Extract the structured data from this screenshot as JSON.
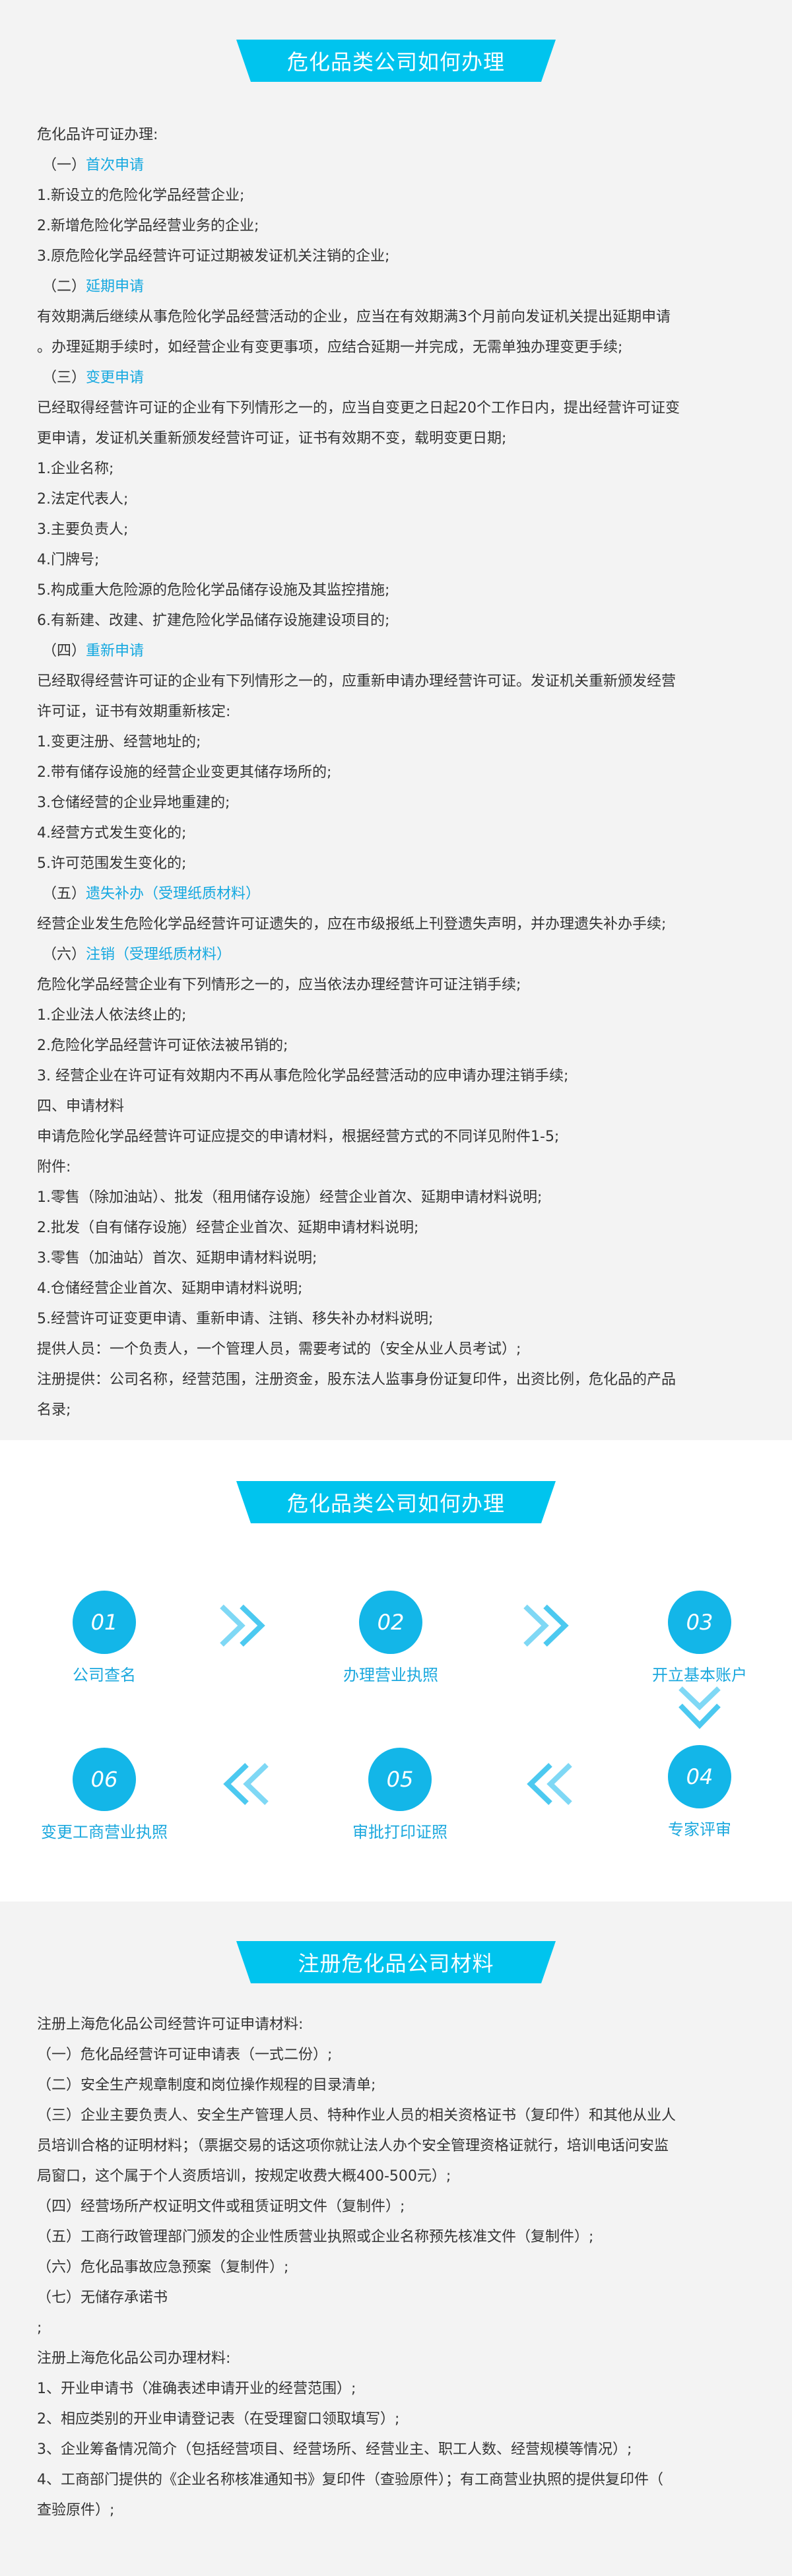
{
  "sec1": {
    "title": "危化品类公司如何办理",
    "lines": [
      {
        "text": "危化品许可证办理:"
      },
      {
        "prefix": "（一）",
        "text": "首次申请",
        "accent": true
      },
      {
        "text": "1.新设立的危险化学品经营企业;"
      },
      {
        "text": "2.新增危险化学品经营业务的企业;"
      },
      {
        "text": "3.原危险化学品经营许可证过期被发证机关注销的企业;"
      },
      {
        "prefix": "（二）",
        "text": "延期申请",
        "accent": true
      },
      {
        "text": "有效期满后继续从事危险化学品经营活动的企业，应当在有效期满3个月前向发证机关提出延期申请"
      },
      {
        "text": "。办理延期手续时，如经营企业有变更事项，应结合延期一并完成，无需单独办理变更手续;"
      },
      {
        "prefix": "（三）",
        "text": "变更申请",
        "accent": true
      },
      {
        "text": "已经取得经营许可证的企业有下列情形之一的，应当自变更之日起20个工作日内，提出经营许可证变"
      },
      {
        "text": "更申请，发证机关重新颁发经营许可证，证书有效期不变，载明变更日期;"
      },
      {
        "text": "1.企业名称;"
      },
      {
        "text": "2.法定代表人;"
      },
      {
        "text": "3.主要负责人;"
      },
      {
        "text": "4.门牌号;"
      },
      {
        "text": "5.构成重大危险源的危险化学品储存设施及其监控措施;"
      },
      {
        "text": "6.有新建、改建、扩建危险化学品储存设施建设项目的;"
      },
      {
        "prefix": "（四）",
        "text": "重新申请",
        "accent": true
      },
      {
        "text": "已经取得经营许可证的企业有下列情形之一的，应重新申请办理经营许可证。发证机关重新颁发经营"
      },
      {
        "text": "许可证，证书有效期重新核定:"
      },
      {
        "text": "1.变更注册、经营地址的;"
      },
      {
        "text": "2.带有储存设施的经营企业变更其储存场所的;"
      },
      {
        "text": "3.仓储经营的企业异地重建的;"
      },
      {
        "text": "4.经营方式发生变化的;"
      },
      {
        "text": "5.许可范围发生变化的;"
      },
      {
        "prefix": "（五）",
        "text": "遗失补办（受理纸质材料）",
        "accent": true
      },
      {
        "text": "经营企业发生危险化学品经营许可证遗失的，应在市级报纸上刊登遗失声明，并办理遗失补办手续;"
      },
      {
        "prefix": "（六）",
        "text": "注销（受理纸质材料）",
        "accent": true
      },
      {
        "text": "危险化学品经营企业有下列情形之一的，应当依法办理经营许可证注销手续;"
      },
      {
        "text": "1.企业法人依法终止的;"
      },
      {
        "text": "2.危险化学品经营许可证依法被吊销的;"
      },
      {
        "text": "3. 经营企业在许可证有效期内不再从事危险化学品经营活动的应申请办理注销手续;"
      },
      {
        "text": "四、申请材料"
      },
      {
        "text": "申请危险化学品经营许可证应提交的申请材料，根据经营方式的不同详见附件1-5;"
      },
      {
        "text": "附件:"
      },
      {
        "text": "1.零售（除加油站）、批发（租用储存设施）经营企业首次、延期申请材料说明;"
      },
      {
        "text": "2.批发（自有储存设施）经营企业首次、延期申请材料说明;"
      },
      {
        "text": "3.零售（加油站）首次、延期申请材料说明;"
      },
      {
        "text": "4.仓储经营企业首次、延期申请材料说明;"
      },
      {
        "text": "5.经营许可证变更申请、重新申请、注销、移失补办材料说明;"
      },
      {
        "text": "提供人员：一个负责人，一个管理人员，需要考试的（安全从业人员考试）;"
      },
      {
        "text": "注册提供：公司名称，经营范围，注册资金，股东法人监事身份证复印件，出资比例，危化品的产品"
      },
      {
        "text": "名录;"
      }
    ]
  },
  "sec2": {
    "title": "危化品类公司如何办理",
    "steps": [
      {
        "num": "01",
        "label": "公司查名"
      },
      {
        "num": "02",
        "label": "办理营业执照"
      },
      {
        "num": "03",
        "label": "开立基本账户"
      },
      {
        "num": "04",
        "label": "专家评审"
      },
      {
        "num": "05",
        "label": "审批打印证照"
      },
      {
        "num": "06",
        "label": "变更工商营业执照"
      }
    ],
    "colors": {
      "circle": "#13b6e8",
      "label": "#1ba8de",
      "arrow": "#7fd8f5"
    }
  },
  "sec3": {
    "title": "注册危化品公司材料",
    "lines": [
      {
        "text": "注册上海危化品公司经营许可证申请材料:"
      },
      {
        "text": "（一）危化品经营许可证申请表（一式二份）;"
      },
      {
        "text": "（二）安全生产规章制度和岗位操作规程的目录清单;"
      },
      {
        "text": "（三）企业主要负责人、安全生产管理人员、特种作业人员的相关资格证书（复印件）和其他从业人"
      },
      {
        "text": "员培训合格的证明材料；（票据交易的话这项你就让法人办个安全管理资格证就行，培训电话问安监"
      },
      {
        "text": "局窗口，这个属于个人资质培训，按规定收费大概400-500元）;"
      },
      {
        "text": "（四）经营场所产权证明文件或租赁证明文件（复制件）;"
      },
      {
        "text": "（五）工商行政管理部门颁发的企业性质营业执照或企业名称预先核准文件（复制件）;"
      },
      {
        "text": "（六）危化品事故应急预案（复制件）;"
      },
      {
        "text": "（七）无储存承诺书"
      },
      {
        "text": ";"
      },
      {
        "text": "注册上海危化品公司办理材料:"
      },
      {
        "text": "1、开业申请书（准确表述申请开业的经营范围）;"
      },
      {
        "text": "2、相应类别的开业申请登记表（在受理窗口领取填写）;"
      },
      {
        "text": "3、企业筹备情况简介（包括经营项目、经营场所、经营业主、职工人数、经营规模等情况）;"
      },
      {
        "text": "4、工商部门提供的《企业名称核准通知书》复印件（查验原件）；有工商营业执照的提供复印件（"
      },
      {
        "text": "查验原件）;"
      }
    ]
  }
}
